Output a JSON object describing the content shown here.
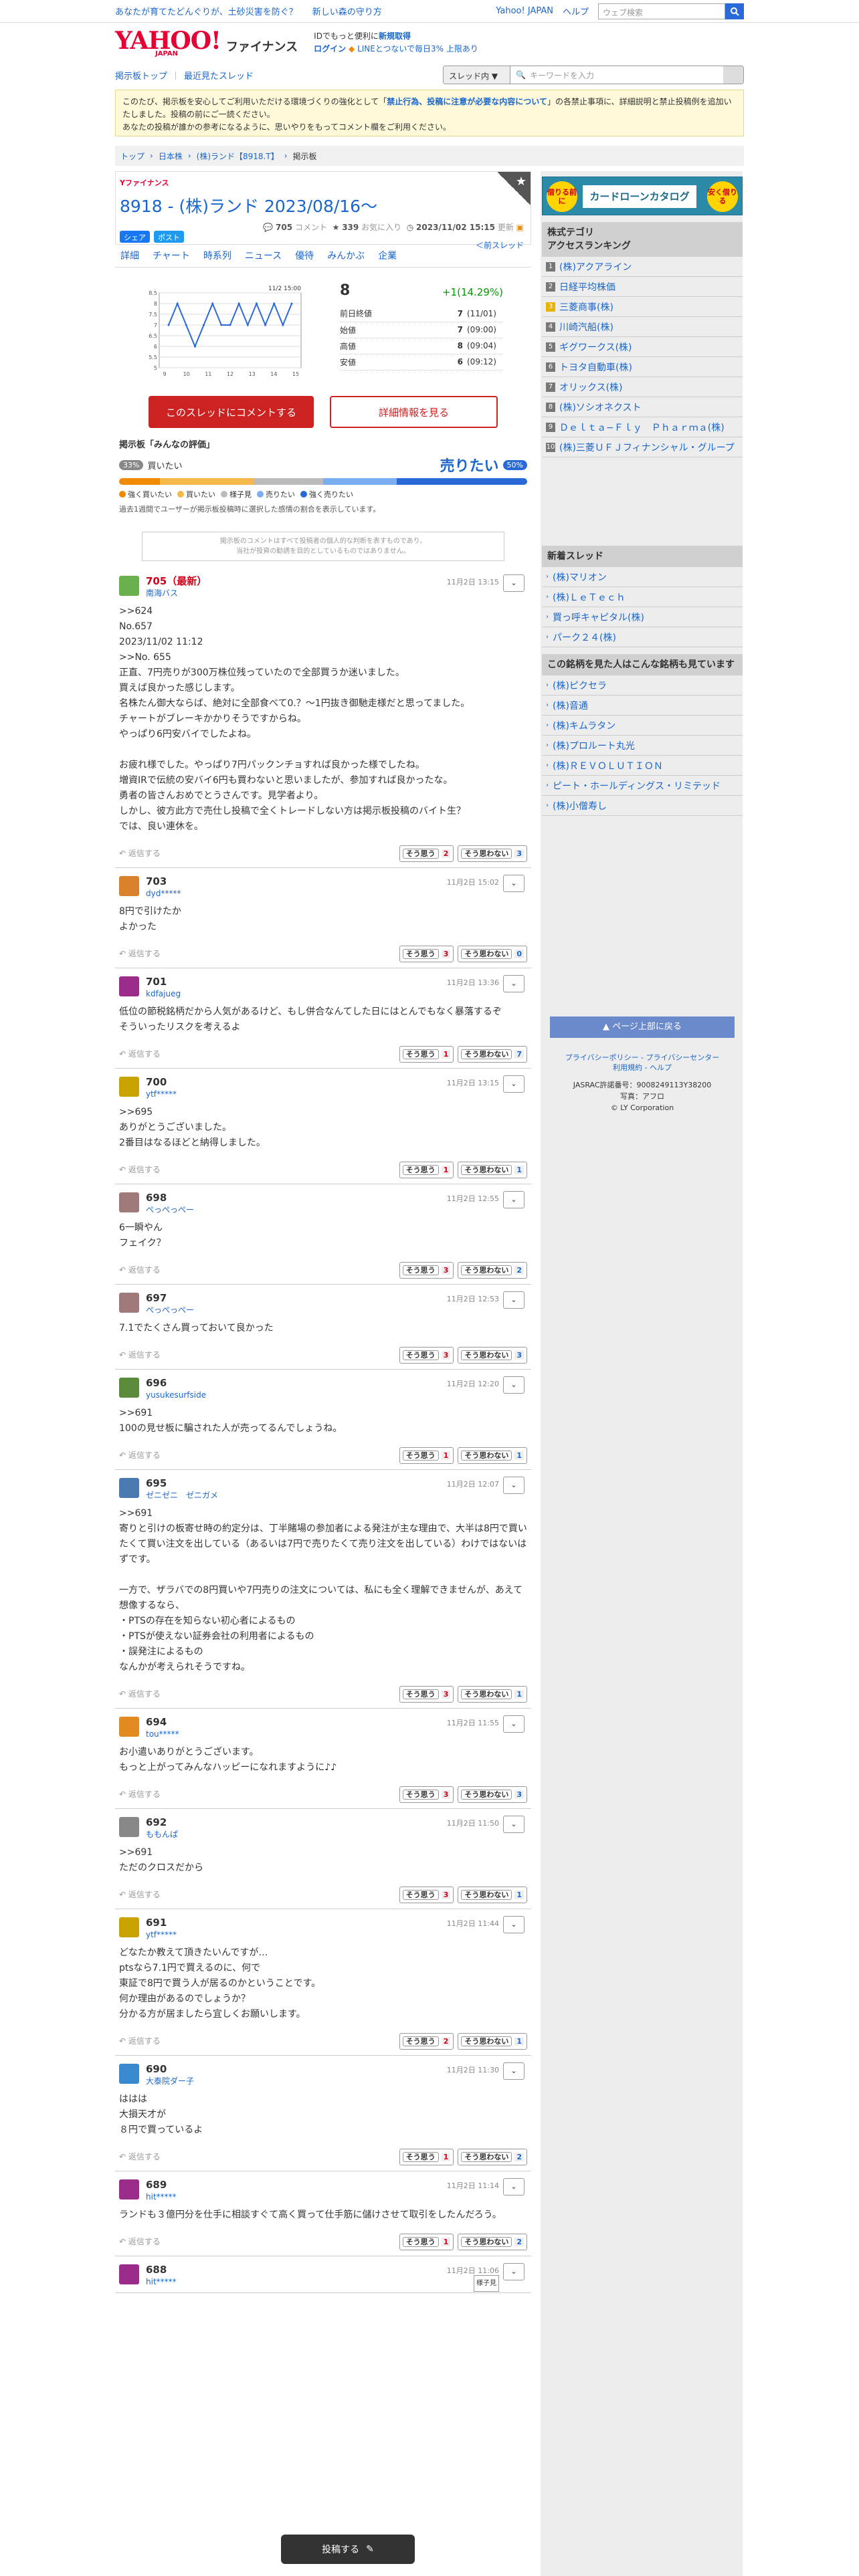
{
  "topbar": {
    "promo1": "あなたが育てたどんぐりが、土砂災害を防ぐ？",
    "promo2": "新しい森の守り方",
    "yj": "Yahoo! JAPAN",
    "help": "ヘルプ",
    "search_placeholder": "ウェブ検索"
  },
  "header": {
    "logo": "YAHOO!",
    "logo_sub": "JAPAN",
    "finance": "ファイナンス",
    "id_text": "IDでもっと便利に",
    "register": "新規取得",
    "login": "ログイン",
    "line": "LINEとつないで毎日3% 上限あり"
  },
  "nav": {
    "bbs_top": "掲示板トップ",
    "recent": "最近見たスレッド",
    "select": "スレッド内",
    "search_placeholder": "キーワードを入力"
  },
  "notice": {
    "pre": "このたび、掲示板を安心してご利用いただける環境づくりの強化として「",
    "bold": "禁止行為、投稿に注意が必要な内容について",
    "post": "」の各禁止事項に、詳細説明と禁止投稿例を追加いたしました。投稿の前にご一読ください。",
    "line2": "あなたの投稿が誰かの参考になるように、思いやりをもってコメント欄をご利用ください。"
  },
  "breadcrumb": [
    "トップ",
    "日本株",
    "(株)ランド【8918.T】",
    "掲示板"
  ],
  "thread": {
    "brand": "Yファイナンス",
    "title": "8918 - (株)ランド 2023/08/16〜",
    "comments": "705",
    "comments_label": "コメント",
    "stars": "339",
    "stars_label": "お気に入り",
    "updated": "2023/11/02 15:15",
    "updated_label": "更新",
    "newthread": "＜前スレッド",
    "fb": "シェア",
    "tw": "ポスト"
  },
  "tabs": [
    "詳細",
    "チャート",
    "時系列",
    "ニュース",
    "優待",
    "みんかぶ",
    "企業"
  ],
  "stock": {
    "chart_time": "11/2 15:00",
    "price": "8",
    "change": "+1(14.29%)",
    "rows": [
      {
        "label": "前日終値",
        "value": "7",
        "time": "(11/01)"
      },
      {
        "label": "始値",
        "value": "7",
        "time": "(09:00)"
      },
      {
        "label": "高値",
        "value": "8",
        "time": "(09:04)"
      },
      {
        "label": "安値",
        "value": "6",
        "time": "(09:12)"
      }
    ],
    "comment_btn": "このスレッドにコメントする",
    "detail_btn": "詳細情報を見る"
  },
  "chart_data": {
    "type": "line",
    "title": "",
    "ylim": [
      5,
      8.5
    ],
    "y_ticks": [
      "8.5",
      "8",
      "7.5",
      "7",
      "6.5",
      "6",
      "5.5",
      "5"
    ],
    "x_ticks": [
      "9",
      "10",
      "11",
      "12",
      "13",
      "14",
      "15"
    ],
    "series": [
      {
        "values": [
          7,
          8,
          7,
          6,
          7,
          8,
          7,
          7,
          8,
          7,
          8,
          7,
          8,
          7,
          8
        ]
      }
    ]
  },
  "evaluation": {
    "title": "掲示板「みんなの評価」",
    "buy_label": "買いたい",
    "buy_pct": "33%",
    "sell_label": "売りたい",
    "sell_pct": "50%",
    "shares": [
      10,
      23,
      17,
      18,
      32
    ],
    "colors": [
      "#f08a00",
      "#f5b84a",
      "#bbbbbb",
      "#7aaef0",
      "#2a6ad8"
    ],
    "legend": [
      "強く買いたい",
      "買いたい",
      "様子見",
      "売りたい",
      "強く売りたい"
    ],
    "note": "過去1週間でユーザーが掲示板投稿時に選択した感情の割合を表示しています。",
    "disclaimer1": "掲示板のコメントはすべて投稿者の個人的な判断を表すものであり、",
    "disclaimer2": "当社が投資の勧誘を目的としているものではありません。"
  },
  "comments": [
    {
      "num": "705（最新）",
      "user": "南海バス",
      "date": "11月2日 13:15",
      "color": "#6ab04c",
      "body": ">>624\nNo.657\n2023/11/02 11:12\n>>No. 655\n正直、7円売りが300万株位残っていたので全部買うか迷いました。\n買えば良かった感じします。\n名株たん御大ならば、絶対に全部食べて0.？〜1円抜き御馳走様だと思ってました。\nチャートがブレーキかかりそうですからね。\nやっぱり6円安バイでしたよね。\n\nお疲れ様でした。やっぱり7円パックンチョすれば良かった様でしたね。\n増資IRで伝統の安バイ6円も買わないと思いましたが、参加すれば良かったな。\n勇者の皆さんおめでとうさんです。見学者より。\nしかし、彼方此方で売仕し投稿で全くトレードしない方は掲示板投稿のバイト生？\nでは、良い連休を。",
      "yes": "2",
      "no": "3",
      "red": true
    },
    {
      "num": "703",
      "user": "dyd*****",
      "date": "11月2日 15:02",
      "color": "#d9822b",
      "body": "8円で引けたか\nよかった",
      "yes": "3",
      "no": "0"
    },
    {
      "num": "701",
      "user": "kdfajueg",
      "date": "11月2日 13:36",
      "color": "#9b2c8a",
      "body": "低位の節税銘柄だから人気があるけど、もし併合なんてした日にはとんでもなく暴落するぞ\nそういったリスクを考えるよ",
      "yes": "1",
      "no": "7"
    },
    {
      "num": "700",
      "user": "ytf*****",
      "date": "11月2日 13:15",
      "color": "#c9a400",
      "body": ">>695\nありがとうございました。\n2番目はなるほどと納得しました。",
      "yes": "1",
      "no": "1"
    },
    {
      "num": "698",
      "user": "ぺっぺっぺー",
      "date": "11月2日 12:55",
      "color": "#a07a7a",
      "body": "6一瞬やん\nフェイク？",
      "yes": "3",
      "no": "2"
    },
    {
      "num": "697",
      "user": "ぺっぺっぺー",
      "date": "11月2日 12:53",
      "color": "#a07a7a",
      "body": "7.1でたくさん買っておいて良かった",
      "yes": "3",
      "no": "3"
    },
    {
      "num": "696",
      "user": "yusukesurfside",
      "date": "11月2日 12:20",
      "color": "#5b8a3a",
      "body": ">>691\n100の見せ板に騙された人が売ってるんでしょうね。",
      "yes": "1",
      "no": "1"
    },
    {
      "num": "695",
      "user": "ゼニゼニ　ゼニガメ",
      "date": "11月2日 12:07",
      "color": "#4a7ab0",
      "body": ">>691\n寄りと引けの板寄せ時の約定分は、丁半賭場の参加者による発注が主な理由で、大半は8円で買いたくて買い注文を出している（あるいは7円で売りたくて売り注文を出している）わけではないはずです。\n\n一方で、ザラバでの8円買いや7円売りの注文については、私にも全く理解できませんが、あえて想像するなら、\n・PTSの存在を知らない初心者によるもの\n・PTSが使えない証券会社の利用者によるもの\n・誤発注によるもの\nなんかが考えられそうですね。",
      "yes": "3",
      "no": "1"
    },
    {
      "num": "694",
      "user": "tou*****",
      "date": "11月2日 11:55",
      "color": "#e08a20",
      "body": "お小遣いありがとうございます。\nもっと上がってみんなハッピーになれますように♪♪",
      "yes": "3",
      "no": "3"
    },
    {
      "num": "692",
      "user": "ももんぱ",
      "date": "11月2日 11:50",
      "color": "#888888",
      "body": ">>691\nただのクロスだから",
      "yes": "3",
      "no": "1"
    },
    {
      "num": "691",
      "user": "ytf*****",
      "date": "11月2日 11:44",
      "color": "#c9a400",
      "body": "どなたか教えて頂きたいんですが…\nptsなら7.1円で買えるのに、何で\n東証で8円で買う人が居るのかということです。\n何か理由があるのでしょうか？\n分かる方が居ましたら宜しくお願いします。",
      "yes": "2",
      "no": "1"
    },
    {
      "num": "690",
      "user": "大泰院ダー子",
      "date": "11月2日 11:30",
      "color": "#3a8ad0",
      "body": "ははは\n大損天才が\n８円で買っているよ",
      "yes": "1",
      "no": "2"
    },
    {
      "num": "689",
      "user": "hit*****",
      "date": "11月2日 11:14",
      "color": "#9b2c8a",
      "body": "ランドも３億円分を仕手に相談すぐて高く買って仕手筋に儲けさせて取引をしたんだろう。",
      "yes": "1",
      "no": "2"
    },
    {
      "num": "688",
      "user": "hit*****",
      "date": "11月2日 11:06",
      "color": "#9b2c8a",
      "body": "",
      "yes": "",
      "no": ""
    }
  ],
  "comment_labels": {
    "reply": "返信する",
    "yes": "そう思う",
    "no": "そう思わない",
    "tag": "様子見"
  },
  "sidebar": {
    "ad_title": "カードローンカタログ",
    "ad_c1": "借りる前に",
    "ad_c2": "安く借りる",
    "ranking_title": "株式テゴリ\nアクセスランキング",
    "ranking": [
      "(株)アクアライン",
      "日経平均株価",
      "三菱商事(株)",
      "川崎汽船(株)",
      "ギグワークス(株)",
      "トヨタ自動車(株)",
      "オリックス(株)",
      "(株)ソシオネクスト",
      "Ｄｅｌｔａ−Ｆｌｙ　Ｐｈａｒｍａ(株)",
      "(株)三菱ＵＦＪフィナンシャル・グループ"
    ],
    "new_title": "新着スレッド",
    "new_threads": [
      "(株)マリオン",
      "(株)ＬｅＴｅｃｈ",
      "買っ呼キャピタル(株)",
      "パーク２４(株)"
    ],
    "also_title": "この銘柄を見た人はこんな銘柄も見ています",
    "also": [
      "(株)ピクセラ",
      "(株)音通",
      "(株)キムラタン",
      "(株)プロルート丸光",
      "(株)ＲＥＶＯＬＵＴＩＯＮ",
      "ピート・ホールディングス・リミテッド",
      "(株)小僧寿し"
    ],
    "top_btn": "ページ上部に戻る",
    "links1": "プライバシーポリシー - プライバシーセンター",
    "links2": "利用規約 - ヘルプ",
    "jasrac": "JASRAC許諾番号：9008249113Y38200",
    "photo": "写真：アフロ",
    "copyright": "© LY Corporation"
  },
  "post_btn": "投稿する"
}
